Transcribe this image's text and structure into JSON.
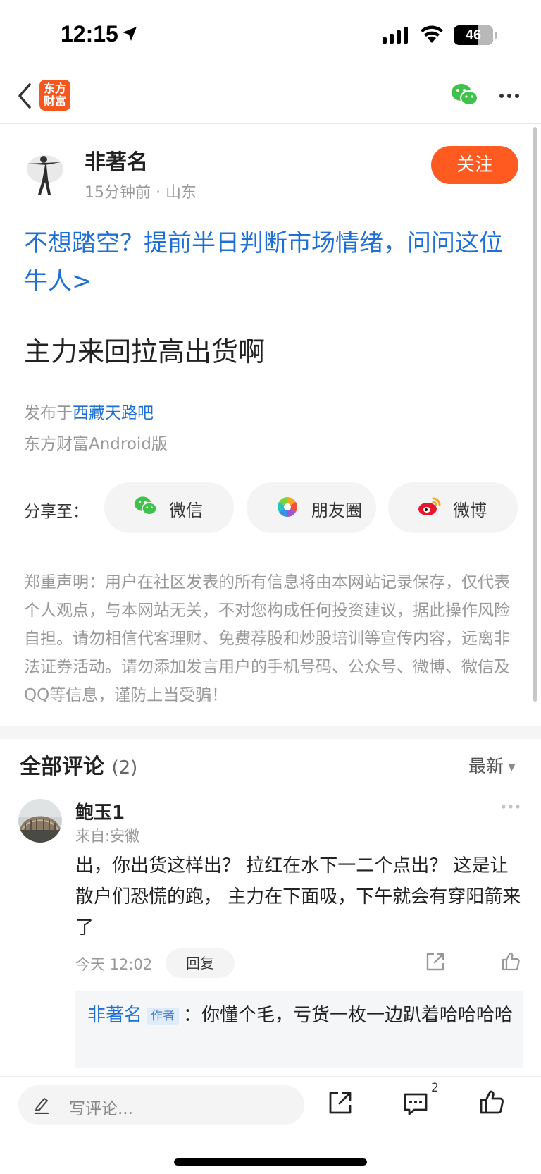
{
  "status_bar": {
    "time": "12:15",
    "battery": "46"
  },
  "nav": {
    "app_logo": "东方财富",
    "app_logo_line1": "东方",
    "app_logo_line2": "财富"
  },
  "post": {
    "author_name": "非著名",
    "meta": "15分钟前 · 山东",
    "follow_label": "关注",
    "promo_link": "不想踏空？提前半日判断市场情绪，问问这位牛人>",
    "title": "主力来回拉高出货啊",
    "published_prefix": "发布于",
    "forum_name": "西藏天路吧",
    "client": "东方财富Android版"
  },
  "share": {
    "label": "分享至：",
    "wechat": "微信",
    "moments": "朋友圈",
    "weibo": "微博"
  },
  "disclaimer": "郑重声明：用户在社区发表的所有信息将由本网站记录保存，仅代表个人观点，与本网站无关，不对您构成任何投资建议，据此操作风险自担。请勿相信代客理财、免费荐股和炒股培训等宣传内容，远离非法证券活动。请勿添加发言用户的手机号码、公众号、微博、微信及QQ等信息，谨防上当受骗！",
  "comments": {
    "title": "全部评论",
    "count": "(2)",
    "sort": "最新",
    "items": [
      {
        "name": "鲍玉1",
        "from": "来自:安徽",
        "body": "出，你出货这样出？ 拉红在水下一二个点出？ 这是让散户们恐慌的跑， 主力在下面吸，下午就会有穿阳箭来了",
        "time": "今天 12:02",
        "reply_label": "回复",
        "reply": {
          "author": "非著名",
          "tag": "作者",
          "separator": "：",
          "text": "你懂个毛，亏货一枚一边趴着哈哈哈哈"
        }
      }
    ]
  },
  "bottom_bar": {
    "placeholder": "写评论...",
    "comment_count": "2"
  },
  "colors": {
    "accent": "#ff5a1f",
    "link": "#1e6fd6",
    "wechat_green": "#3fc24a"
  }
}
